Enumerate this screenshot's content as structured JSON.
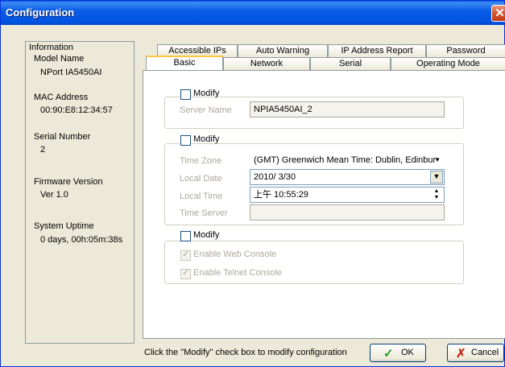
{
  "window": {
    "title": "Configuration",
    "close_glyph": "✕"
  },
  "info": {
    "title": "Information",
    "model_name_label": "Model Name",
    "model_name_value": "NPort IA5450AI",
    "mac_label": "MAC Address",
    "mac_value": "00:90:E8:12:34:57",
    "serial_label": "Serial Number",
    "serial_value": "2",
    "firmware_label": "Firmware Version",
    "firmware_value": "Ver 1.0",
    "uptime_label": "System Uptime",
    "uptime_value": "0 days, 00h:05m:38s"
  },
  "tabs": {
    "row1": [
      "Accessible IPs",
      "Auto Warning",
      "IP Address Report",
      "Password"
    ],
    "row2": [
      "Basic",
      "Network",
      "Serial",
      "Operating Mode"
    ],
    "selected": "Basic"
  },
  "basic": {
    "modify_label": "Modify",
    "server_name_label": "Server Name",
    "server_name_value": "NPIA5450AI_2",
    "time": {
      "modify_label": "Modify",
      "time_zone_label": "Time Zone",
      "time_zone_value": "(GMT) Greenwich Mean Time: Dublin, Edinbur",
      "local_date_label": "Local Date",
      "local_date_value": "2010/ 3/30",
      "local_time_label": "Local Time",
      "local_time_value": "上午 10:55:29",
      "time_server_label": "Time Server",
      "time_server_value": ""
    },
    "console": {
      "modify_label": "Modify",
      "web_console_label": "Enable Web Console",
      "telnet_console_label": "Enable Telnet Console"
    }
  },
  "footer": {
    "status_text": "Click the \"Modify\" check box to modify configuration",
    "ok_label": "OK",
    "cancel_label": "Cancel"
  },
  "colors": {
    "title_bar": "#0a5ee8",
    "dialog_bg": "#ece9d8",
    "ok_icon": "#2a9c1f",
    "cancel_icon": "#c8301e"
  },
  "icons": {
    "ok": "checkmark-icon",
    "cancel": "x-icon"
  }
}
